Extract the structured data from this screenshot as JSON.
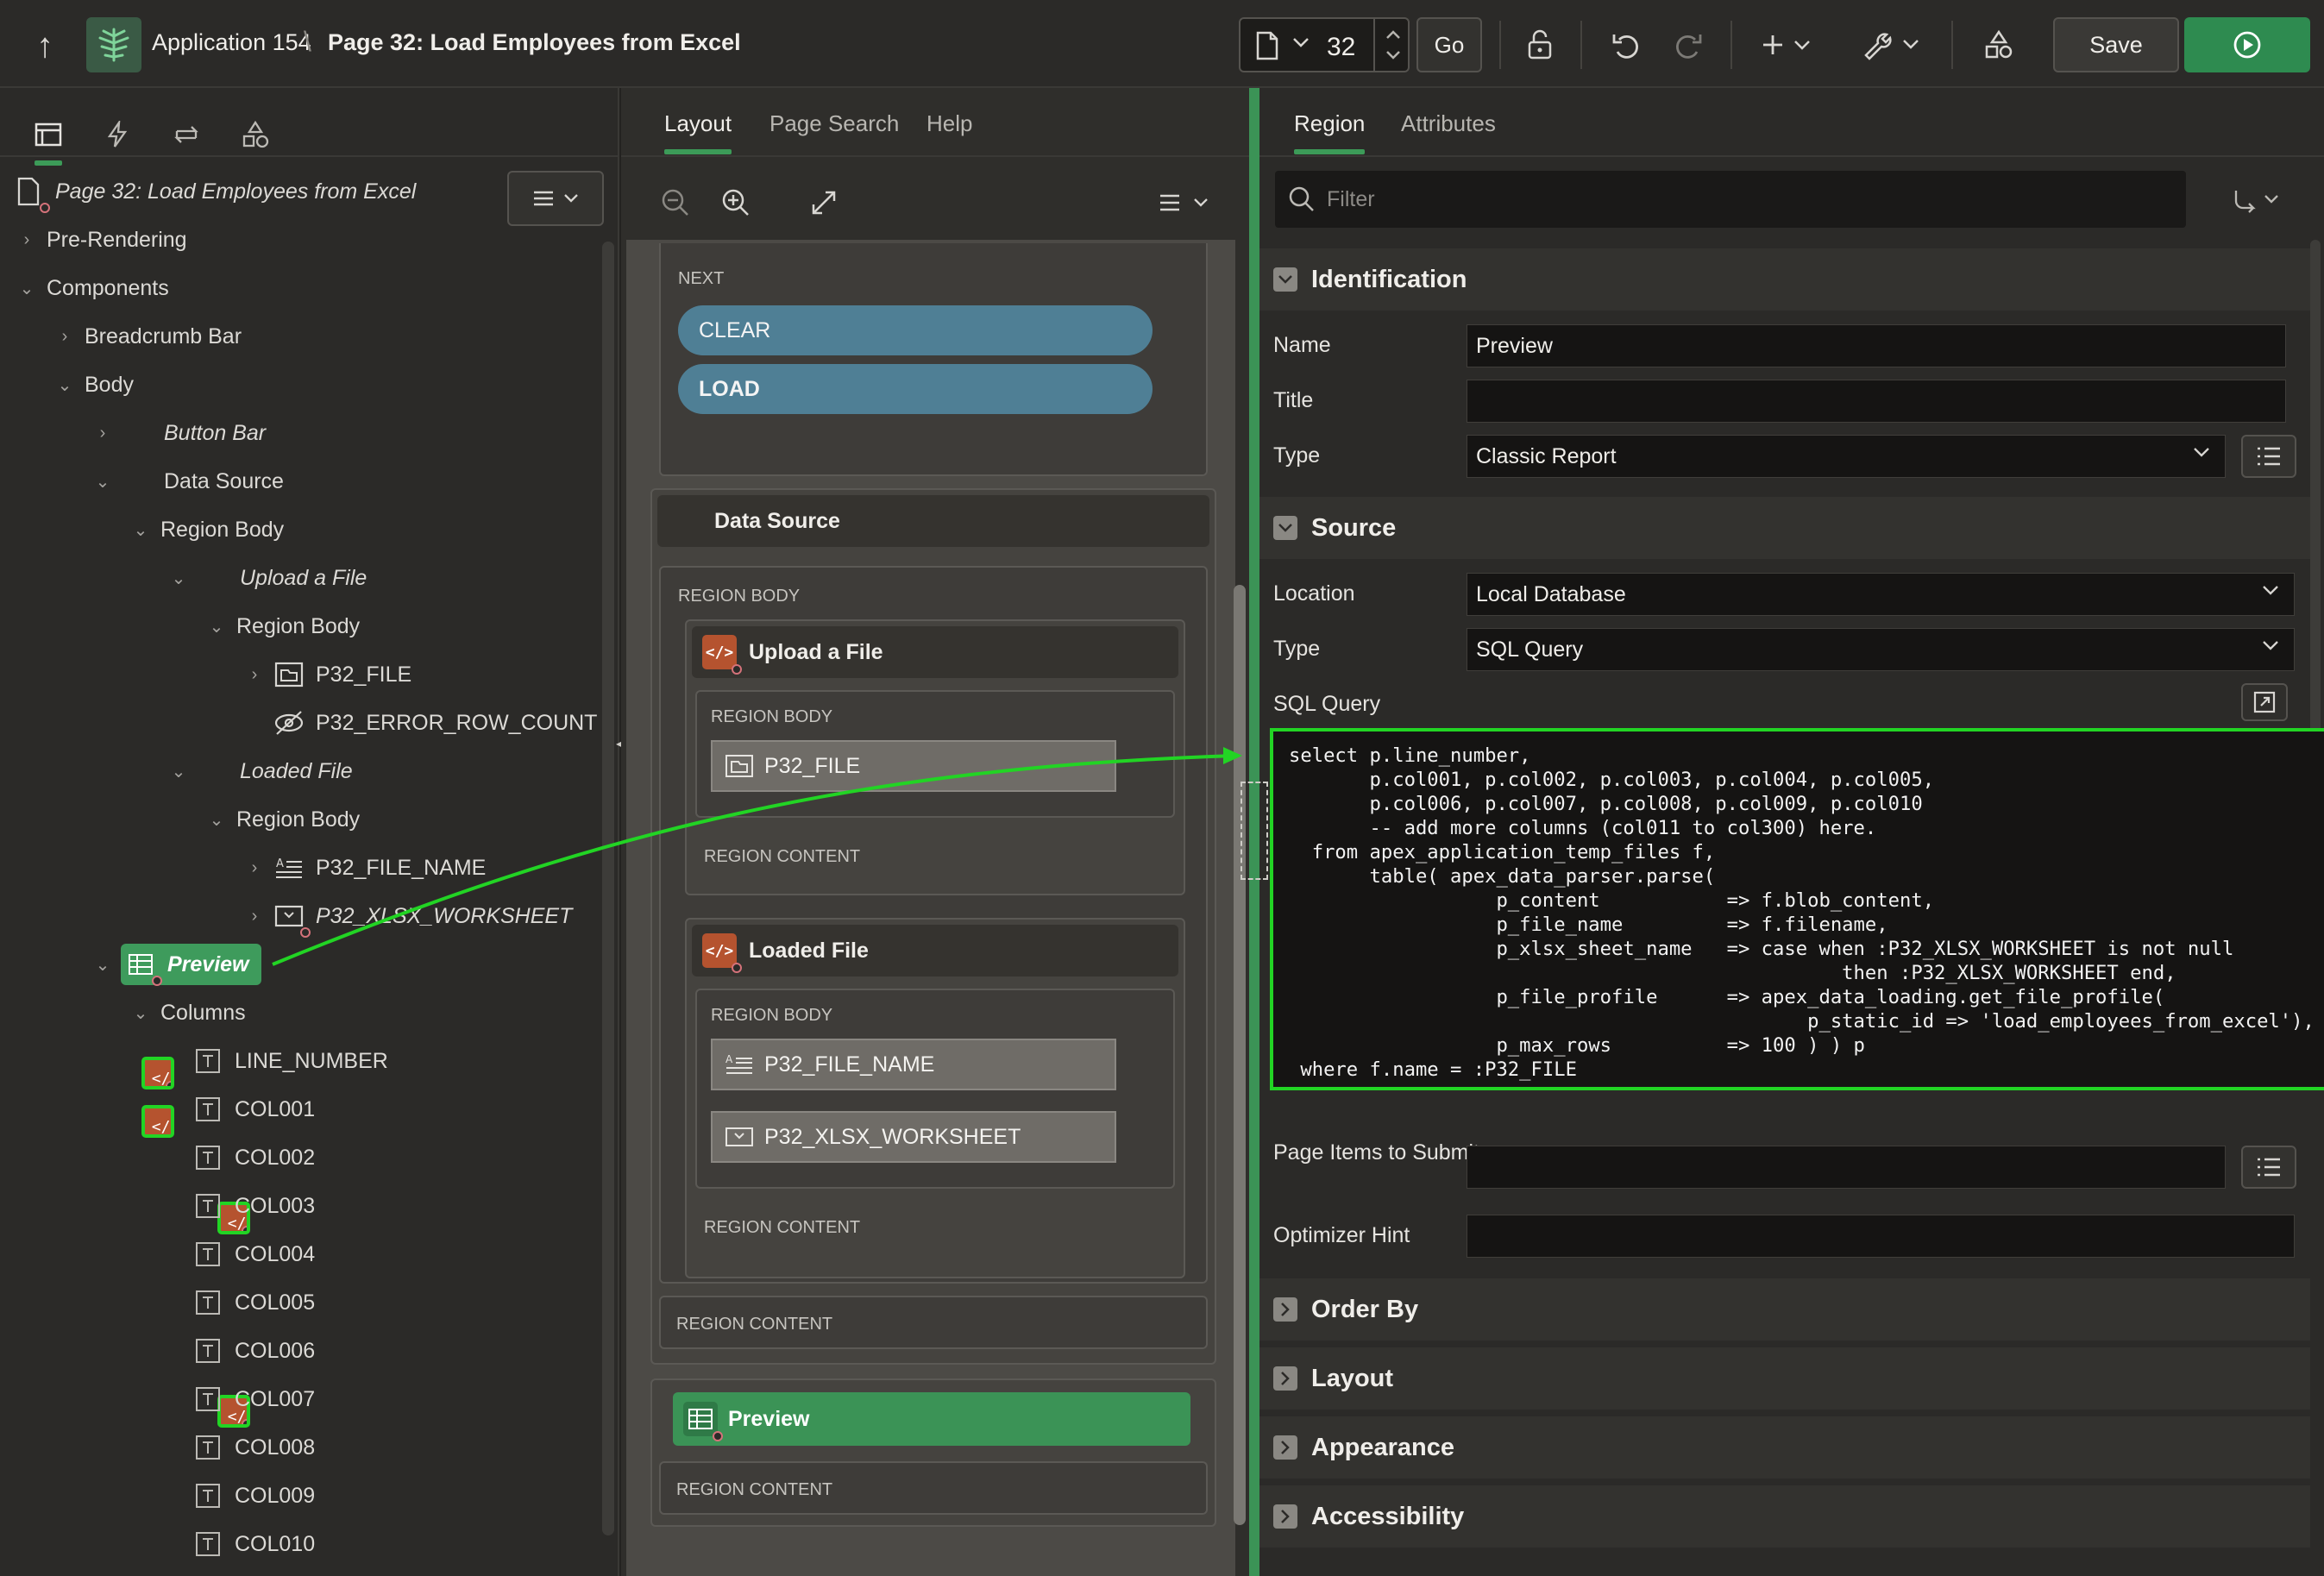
{
  "topbar": {
    "app_title": "Application 154",
    "page_title": "Page 32: Load Employees from Excel",
    "page_number": "32",
    "go_label": "Go",
    "save_label": "Save"
  },
  "tree": {
    "root": "Page 32: Load Employees from Excel",
    "items": [
      {
        "label": "Pre-Rendering"
      },
      {
        "label": "Components"
      },
      {
        "label": "Breadcrumb Bar"
      },
      {
        "label": "Body"
      },
      {
        "label": "Button Bar"
      },
      {
        "label": "Data Source"
      },
      {
        "label": "Region Body"
      },
      {
        "label": "Upload a File"
      },
      {
        "label": "Region Body"
      },
      {
        "label": "P32_FILE"
      },
      {
        "label": "P32_ERROR_ROW_COUNT"
      },
      {
        "label": "Loaded File"
      },
      {
        "label": "Region Body"
      },
      {
        "label": "P32_FILE_NAME"
      },
      {
        "label": "P32_XLSX_WORKSHEET"
      },
      {
        "label": "Preview"
      },
      {
        "label": "Columns"
      },
      {
        "label": "LINE_NUMBER"
      },
      {
        "label": "COL001"
      },
      {
        "label": "COL002"
      },
      {
        "label": "COL003"
      },
      {
        "label": "COL004"
      },
      {
        "label": "COL005"
      },
      {
        "label": "COL006"
      },
      {
        "label": "COL007"
      },
      {
        "label": "COL008"
      },
      {
        "label": "COL009"
      },
      {
        "label": "COL010"
      }
    ]
  },
  "middle": {
    "tabs": [
      "Layout",
      "Page Search",
      "Help"
    ],
    "next_caption": "NEXT",
    "clear_label": "CLEAR",
    "load_label": "LOAD",
    "data_source_title": "Data Source",
    "region_body": "REGION BODY",
    "region_content": "REGION CONTENT",
    "upload_title": "Upload a File",
    "p32_file": "P32_FILE",
    "loaded_title": "Loaded File",
    "p32_file_name": "P32_FILE_NAME",
    "p32_xlsx_worksheet": "P32_XLSX_WORKSHEET",
    "preview_title": "Preview"
  },
  "right": {
    "tabs": [
      "Region",
      "Attributes"
    ],
    "filter_placeholder": "Filter",
    "identification": {
      "title": "Identification",
      "name_label": "Name",
      "name_value": "Preview",
      "title_label": "Title",
      "title_value": "",
      "type_label": "Type",
      "type_value": "Classic Report"
    },
    "source": {
      "title": "Source",
      "location_label": "Location",
      "location_value": "Local Database",
      "type_label": "Type",
      "type_value": "SQL Query",
      "sql_label": "SQL Query",
      "sql": "select p.line_number,\n       p.col001, p.col002, p.col003, p.col004, p.col005,\n       p.col006, p.col007, p.col008, p.col009, p.col010\n       -- add more columns (col011 to col300) here.\n  from apex_application_temp_files f,\n       table( apex_data_parser.parse(\n                  p_content           => f.blob_content,\n                  p_file_name         => f.filename,\n                  p_xlsx_sheet_name   => case when :P32_XLSX_WORKSHEET is not null\n                                                then :P32_XLSX_WORKSHEET end,\n                  p_file_profile      => apex_data_loading.get_file_profile(\n                                             p_static_id => 'load_employees_from_excel'),\n                  p_max_rows          => 100 ) ) p\n where f.name = :P32_FILE",
      "items_submit_label": "Page Items to Submit",
      "optimizer_label": "Optimizer Hint"
    },
    "sections": [
      "Order By",
      "Layout",
      "Appearance",
      "Accessibility"
    ]
  },
  "colors": {
    "accent_green": "#3b9356",
    "highlight_green": "#22d424",
    "code_orange": "#b5532f",
    "button_blue": "#4f7f95"
  }
}
